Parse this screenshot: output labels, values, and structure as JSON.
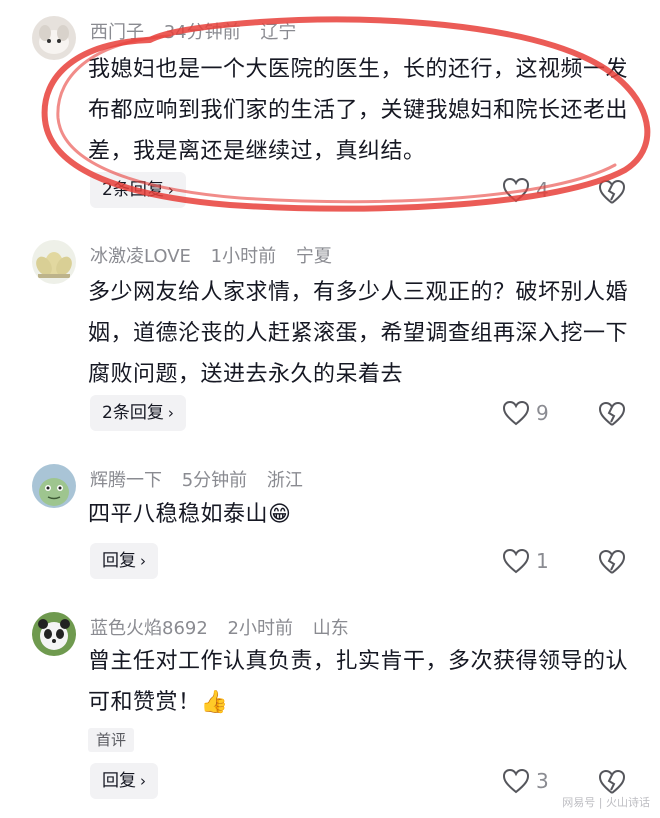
{
  "comments": [
    {
      "user": "西门子",
      "time": "34分钟前",
      "location": "辽宁",
      "text": "我媳妇也是一个大医院的医生，长的还行，这视频一发布都应响到我们家的生活了，关键我媳妇和院长还老出差，我是离还是继续过，真纠结。",
      "reply_label": "2条回复",
      "likes": "4"
    },
    {
      "user": "冰激凌LOVE",
      "time": "1小时前",
      "location": "宁夏",
      "text": "多少网友给人家求情，有多少人三观正的？破坏别人婚姻，道德沦丧的人赶紧滚蛋，希望调查组再深入挖一下腐败问题，送进去永久的呆着去",
      "reply_label": "2条回复",
      "likes": "9"
    },
    {
      "user": "辉腾一下",
      "time": "5分钟前",
      "location": "浙江",
      "text": "四平八稳稳如泰山",
      "emoji": "😁",
      "reply_label": "回复",
      "likes": "1"
    },
    {
      "user": "蓝色火焰8692",
      "time": "2小时前",
      "location": "山东",
      "text": "曾主任对工作认真负责，扎实肯干，多次获得领导的认可和赞赏！",
      "emoji": "👍",
      "tag": "首评",
      "reply_label": "回复",
      "likes": "3"
    }
  ],
  "watermark": "网易号 | 火山诗话",
  "colors": {
    "annotation": "#e8403a",
    "meta": "#8a8b91",
    "text": "#161823"
  },
  "icons": [
    "heart-outline-icon",
    "broken-heart-icon",
    "chevron-right-icon"
  ]
}
